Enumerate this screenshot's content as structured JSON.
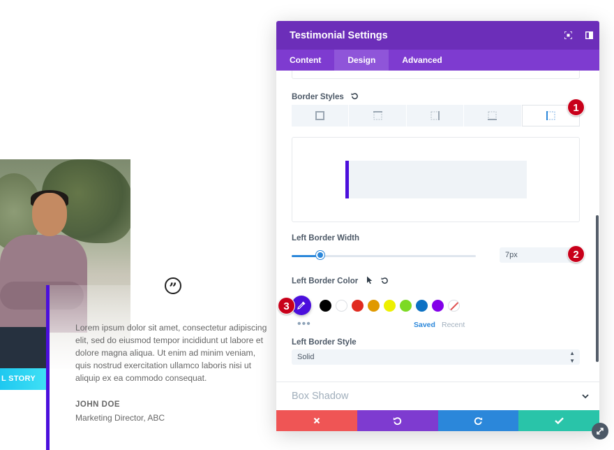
{
  "background_page": {
    "story_button_label": "L STORY",
    "quote_icon": "quote-icon",
    "body_text": "Lorem ipsum dolor sit amet, consectetur adipiscing elit, sed do eiusmod tempor incididunt ut labore et dolore magna aliqua. Ut enim ad minim veniam, quis nostrud exercitation ullamco laboris nisi ut aliquip ex ea commodo consequat.",
    "author_name": "JOHN DOE",
    "author_role": "Marketing Director, ABC",
    "accent_color": "#4b0fdc"
  },
  "modal": {
    "title": "Testimonial Settings",
    "header_icons": [
      "focus-icon",
      "sidebar-icon"
    ],
    "tabs": [
      {
        "label": "Content",
        "active": false
      },
      {
        "label": "Design",
        "active": true
      },
      {
        "label": "Advanced",
        "active": false
      }
    ],
    "border_styles": {
      "label": "Border Styles",
      "options": [
        "all-sides",
        "top",
        "right",
        "bottom",
        "left"
      ],
      "selected": "left"
    },
    "left_border_width": {
      "label": "Left Border Width",
      "value": "7px",
      "slider_percent": 15
    },
    "left_border_color": {
      "label": "Left Border Color",
      "current": "#4b0fdc",
      "swatches": [
        "#000000",
        "#ffffff",
        "#e02b20",
        "#e09900",
        "#edf000",
        "#7cda24",
        "#0c71c3",
        "#8300e9"
      ],
      "saved_label": "Saved",
      "recent_label": "Recent"
    },
    "left_border_style": {
      "label": "Left Border Style",
      "value": "Solid"
    },
    "box_shadow_label": "Box Shadow",
    "footer": {
      "colors": [
        "#ef5555",
        "#7e3bd0",
        "#2b87da",
        "#29c4a9"
      ],
      "icons": [
        "close-icon",
        "undo-icon",
        "redo-icon",
        "check-icon"
      ]
    }
  },
  "annotations": [
    "1",
    "2",
    "3"
  ],
  "colors": {
    "header": "#6c2eb9",
    "tabs": "#7e3bd0",
    "tab_active": "#8f55d9",
    "blue": "#2b87da"
  }
}
